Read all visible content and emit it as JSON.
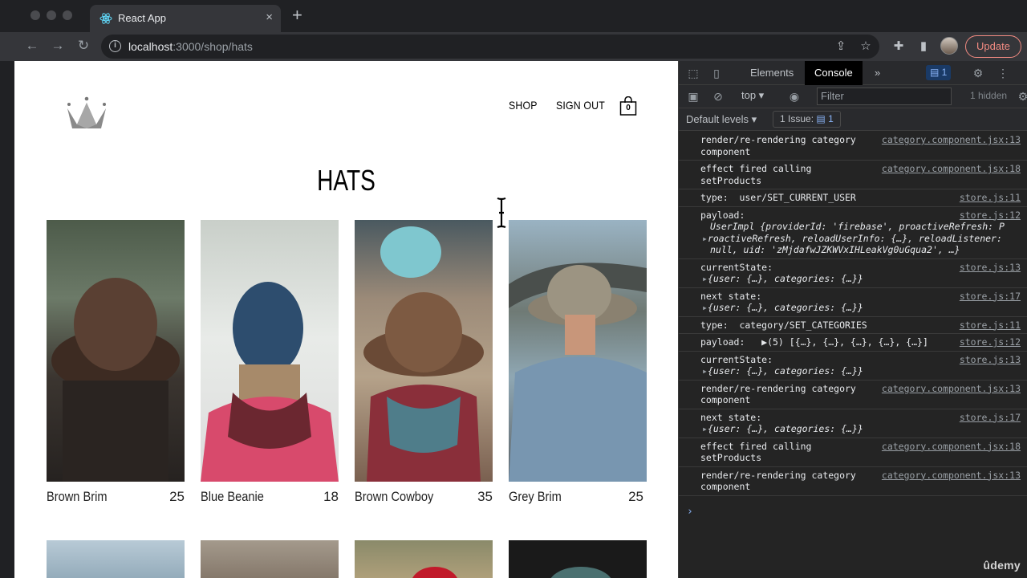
{
  "browser": {
    "tab_title": "React App",
    "tab_close": "×",
    "new_tab": "+",
    "url_host": "localhost",
    "url_path": ":3000/shop/hats",
    "update_label": "Update",
    "icons": [
      "back-icon",
      "forward-icon",
      "reload-icon",
      "info-icon",
      "share-icon",
      "star-icon",
      "extensions-icon",
      "sidepanel-icon",
      "menu-icon"
    ]
  },
  "site": {
    "nav": {
      "shop": "SHOP",
      "sign_out": "SIGN OUT",
      "cart_count": "0"
    },
    "title": "HATS",
    "products": [
      {
        "name": "Brown Brim",
        "price": "25"
      },
      {
        "name": "Blue Beanie",
        "price": "18"
      },
      {
        "name": "Brown Cowboy",
        "price": "35"
      },
      {
        "name": "Grey Brim",
        "price": "25"
      }
    ]
  },
  "devtools": {
    "tabs": {
      "elements": "Elements",
      "console": "Console",
      "more": "»"
    },
    "message_count": "1",
    "context": "top ▾",
    "filter_placeholder": "Filter",
    "hidden": "1 hidden",
    "levels": "Default levels ▾",
    "issues": "1 Issue:",
    "issues_count": "1",
    "logs": [
      {
        "text": "render/re-rendering category",
        "text2": "component",
        "src": "category.component.jsx:13"
      },
      {
        "text": "effect fired calling",
        "text2": "setProducts",
        "src": "category.component.jsx:18"
      },
      {
        "text": "type:  user/SET_CURRENT_USER",
        "src": "store.js:11"
      },
      {
        "text": "payload:",
        "src": "store.js:12",
        "detail1": "UserImpl {providerId: 'firebase', proactiveRefresh: P",
        "detail2": "roactiveRefresh, reloadUserInfo: {…}, reloadListener:",
        "detail3": "null, uid: 'zMjdafwJZKWVxIHLeakVg0uGqua2', …}"
      },
      {
        "text": "currentState:",
        "src": "store.js:13",
        "detail1": "{user: {…}, categories: {…}}"
      },
      {
        "text": "next state:",
        "src": "store.js:17",
        "detail1": "{user: {…}, categories: {…}}"
      },
      {
        "text": "type:  category/SET_CATEGORIES",
        "src": "store.js:11"
      },
      {
        "text": "payload:   ▶(5) [{…}, {…}, {…}, {…}, {…}]",
        "src": "store.js:12"
      },
      {
        "text": "currentState:",
        "src": "store.js:13",
        "detail1": "{user: {…}, categories: {…}}"
      },
      {
        "text": "render/re-rendering category",
        "text2": "component",
        "src": "category.component.jsx:13"
      },
      {
        "text": "next state:",
        "src": "store.js:17",
        "detail1": "{user: {…}, categories: {…}}"
      },
      {
        "text": "effect fired calling",
        "text2": "setProducts",
        "src": "category.component.jsx:18"
      },
      {
        "text": "render/re-rendering category",
        "text2": "component",
        "src": "category.component.jsx:13"
      }
    ],
    "prompt": "›"
  },
  "watermark": "ûdemy"
}
